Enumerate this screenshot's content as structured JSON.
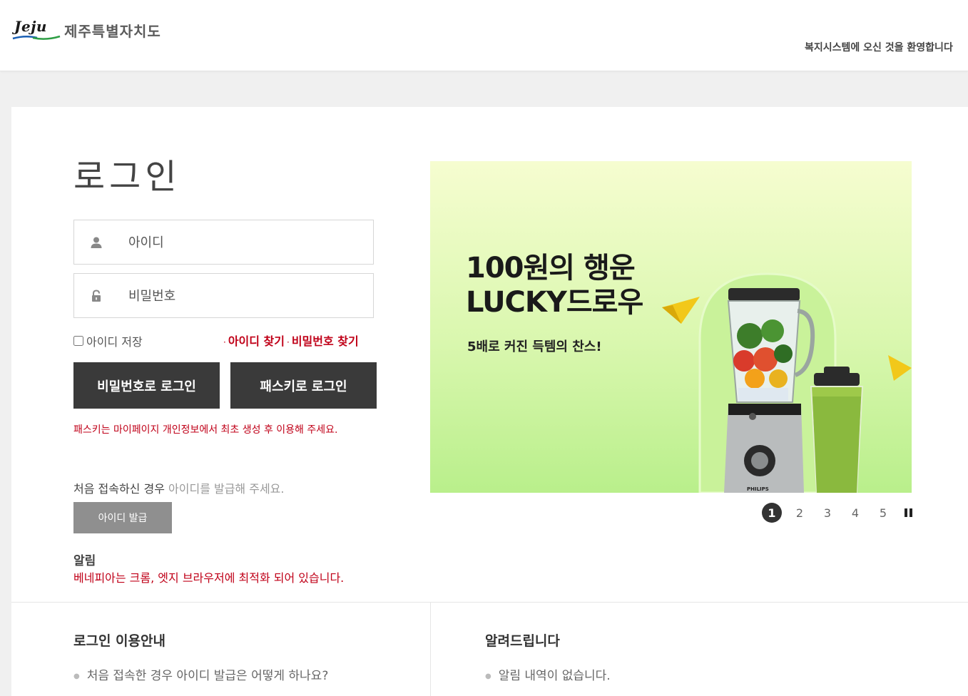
{
  "header": {
    "logo_word": "Jeju",
    "logo_text": "제주특별자치도",
    "welcome": "복지시스템에 오신 것을 환영합니다"
  },
  "login": {
    "title": "로그인",
    "id_placeholder": "아이디",
    "password_placeholder": "비밀번호",
    "save_id_label": "아이디 저장",
    "find_id": "아이디 찾기",
    "find_password": "비밀번호 찾기",
    "password_login_button": "비밀번호로 로그인",
    "passkey_login_button": "패스키로 로그인",
    "passkey_note": "패스키는 마이페이지 개인정보에서 최초 생성 후 이용해 주세요.",
    "first_visit_strong": "처음 접속하신 경우",
    "first_visit_light": "아이디를 발급해 주세요.",
    "issue_button": "아이디 발급",
    "notice_title": "알림",
    "notice_text": "베네피아는 크롬, 엣지 브라우저에 최적화 되어 있습니다."
  },
  "banner": {
    "headline_line1": "100원의 행운",
    "headline_line2": "LUCKY드로우",
    "subline": "5배로 커진 득템의 찬스!",
    "product_brand": "PHILIPS",
    "pages": [
      "1",
      "2",
      "3",
      "4",
      "5"
    ],
    "active_page": "1"
  },
  "guide": {
    "title": "로그인 이용안내",
    "items": [
      "처음 접속한 경우 아이디 발급은 어떻게 하나요?"
    ]
  },
  "announcements": {
    "title": "알려드립니다",
    "items": [
      "알림 내역이 없습니다."
    ]
  },
  "colors": {
    "accent_red": "#c00018",
    "dark_button": "#3a3a3a",
    "gray_button": "#8f8f8f"
  }
}
